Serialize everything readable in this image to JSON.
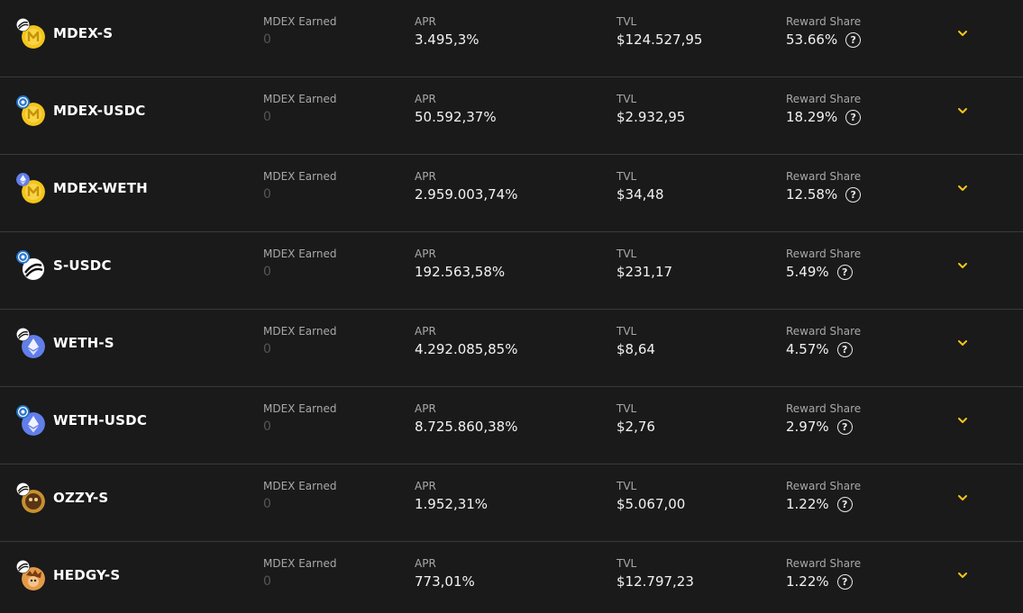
{
  "labels": {
    "earned": "MDEX Earned",
    "apr": "APR",
    "tvl": "TVL",
    "share": "Reward Share"
  },
  "colors": {
    "accent": "#f5c518",
    "background": "#1a1a1a",
    "divider": "#3a3a3a"
  },
  "farms": [
    {
      "name": "MDEX-S",
      "earned": "0",
      "apr": "3.495,3%",
      "tvl": "$124.527,95",
      "share": "53.66%",
      "token_a": "s-token-icon",
      "token_b": "mdex-token-icon"
    },
    {
      "name": "MDEX-USDC",
      "earned": "0",
      "apr": "50.592,37%",
      "tvl": "$2.932,95",
      "share": "18.29%",
      "token_a": "usdc-token-icon",
      "token_b": "mdex-token-icon"
    },
    {
      "name": "MDEX-WETH",
      "earned": "0",
      "apr": "2.959.003,74%",
      "tvl": "$34,48",
      "share": "12.58%",
      "token_a": "weth-token-icon",
      "token_b": "mdex-token-icon"
    },
    {
      "name": "S-USDC",
      "earned": "0",
      "apr": "192.563,58%",
      "tvl": "$231,17",
      "share": "5.49%",
      "token_a": "usdc-token-icon",
      "token_b": "s-token-icon"
    },
    {
      "name": "WETH-S",
      "earned": "0",
      "apr": "4.292.085,85%",
      "tvl": "$8,64",
      "share": "4.57%",
      "token_a": "s-token-icon",
      "token_b": "weth-token-icon"
    },
    {
      "name": "WETH-USDC",
      "earned": "0",
      "apr": "8.725.860,38%",
      "tvl": "$2,76",
      "share": "2.97%",
      "token_a": "usdc-token-icon",
      "token_b": "weth-token-icon"
    },
    {
      "name": "OZZY-S",
      "earned": "0",
      "apr": "1.952,31%",
      "tvl": "$5.067,00",
      "share": "1.22%",
      "token_a": "s-token-icon",
      "token_b": "ozzy-token-icon"
    },
    {
      "name": "HEDGY-S",
      "earned": "0",
      "apr": "773,01%",
      "tvl": "$12.797,23",
      "share": "1.22%",
      "token_a": "s-token-icon",
      "token_b": "hedgy-token-icon"
    }
  ]
}
